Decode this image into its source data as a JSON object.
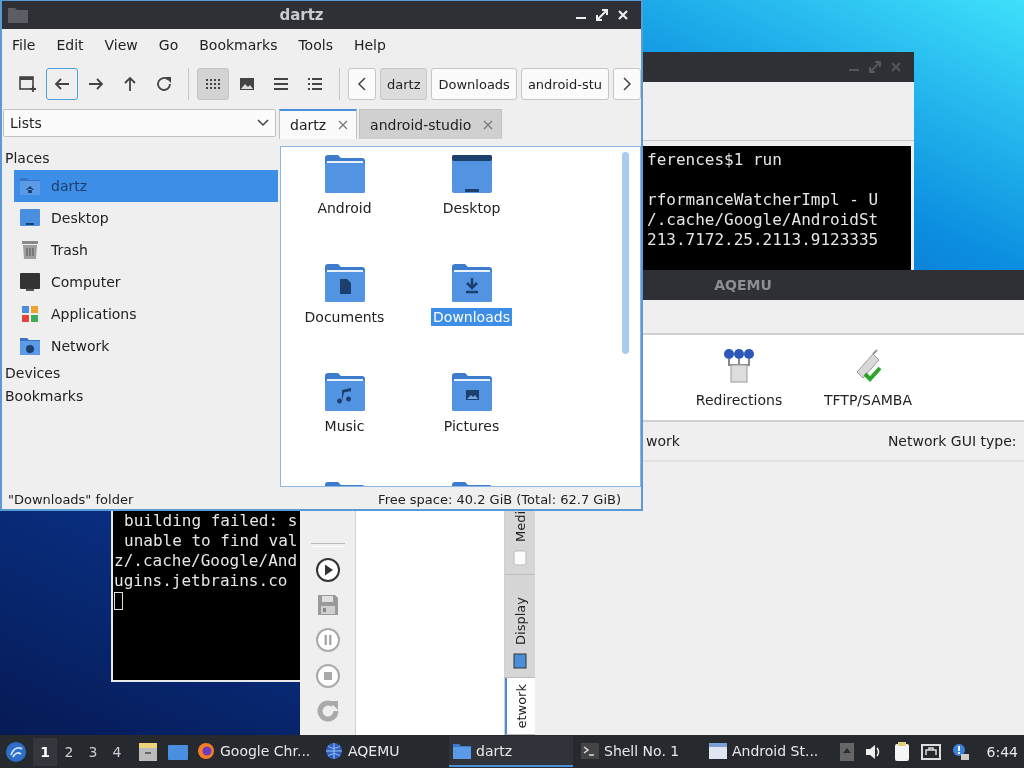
{
  "shell_window": {
    "lines": [
      "building failed: s",
      "unable to find val",
      "z/.cache/Google/And",
      "ugins.jetbrains.co"
    ]
  },
  "android_studio_window": {
    "lines": [
      "ferences$1 run",
      "rformanceWatcherImpl - U",
      "/.cache/Google/AndroidSt",
      "213.7172.25.2113.9123335"
    ]
  },
  "aqemu_window": {
    "title": "AQEMU",
    "tools": [
      {
        "label": "Redirections",
        "kind": "redirections"
      },
      {
        "label": "TFTP/SAMBA",
        "kind": "tftp"
      }
    ],
    "section_label": "work",
    "gui_type_label": "Network GUI type:",
    "side_tabs": [
      {
        "label": "Medi",
        "kind": "media",
        "selected": false
      },
      {
        "label": "Display",
        "kind": "display",
        "selected": false
      },
      {
        "label": "etwork",
        "kind": "network",
        "selected": true
      }
    ]
  },
  "file_manager": {
    "title": "dartz",
    "menu": [
      "File",
      "Edit",
      "View",
      "Go",
      "Bookmarks",
      "Tools",
      "Help"
    ],
    "nav_buttons": [
      {
        "kind": "new-window",
        "focused": false
      },
      {
        "kind": "back",
        "focused": true
      },
      {
        "kind": "forward",
        "focused": false
      },
      {
        "kind": "up",
        "focused": false
      },
      {
        "kind": "reload",
        "focused": false
      }
    ],
    "view_modes": [
      {
        "kind": "icons",
        "selected": true
      },
      {
        "kind": "thumbnails",
        "selected": false
      },
      {
        "kind": "compact",
        "selected": false
      },
      {
        "kind": "detailed",
        "selected": false
      }
    ],
    "path": [
      {
        "label": "dartz",
        "selected": true
      },
      {
        "label": "Downloads",
        "selected": false
      },
      {
        "label": "android-stu",
        "selected": false
      }
    ],
    "side_pane_mode": "Lists",
    "tabs": [
      {
        "label": "dartz",
        "selected": true
      },
      {
        "label": "android-studio",
        "selected": false
      }
    ],
    "places_header": "Places",
    "places": [
      {
        "label": "dartz",
        "kind": "home",
        "selected": true
      },
      {
        "label": "Desktop",
        "kind": "desktop",
        "selected": false
      },
      {
        "label": "Trash",
        "kind": "trash",
        "selected": false
      },
      {
        "label": "Computer",
        "kind": "computer",
        "selected": false
      },
      {
        "label": "Applications",
        "kind": "applications",
        "selected": false
      },
      {
        "label": "Network",
        "kind": "network",
        "selected": false
      }
    ],
    "devices_header": "Devices",
    "bookmarks_header": "Bookmarks",
    "files": [
      {
        "name": "Android",
        "kind": "folder",
        "selected": false
      },
      {
        "name": "Desktop",
        "kind": "desktop",
        "selected": false
      },
      {
        "name": "Documents",
        "kind": "documents",
        "selected": false
      },
      {
        "name": "Downloads",
        "kind": "downloads",
        "selected": true
      },
      {
        "name": "Music",
        "kind": "music",
        "selected": false
      },
      {
        "name": "Pictures",
        "kind": "pictures",
        "selected": false
      },
      {
        "kind": "folder"
      },
      {
        "kind": "folder"
      }
    ],
    "status": "\"Downloads\" folder",
    "free_space": "Free space: 40.2 GiB (Total: 62.7 GiB)"
  },
  "taskbar": {
    "workspaces": [
      {
        "label": "1",
        "selected": true
      },
      {
        "label": "2",
        "selected": false
      },
      {
        "label": "3",
        "selected": false
      },
      {
        "label": "4",
        "selected": false
      }
    ],
    "tasks": [
      {
        "label": "Google Chr...",
        "kind": "browser",
        "selected": false
      },
      {
        "label": "AQEMU",
        "kind": "emulator",
        "selected": false
      },
      {
        "label": "dartz",
        "kind": "folder",
        "selected": true
      },
      {
        "label": "Shell No. 1",
        "kind": "terminal",
        "selected": false
      },
      {
        "label": "Android St...",
        "kind": "window",
        "selected": false
      }
    ],
    "clock": "6:44"
  }
}
